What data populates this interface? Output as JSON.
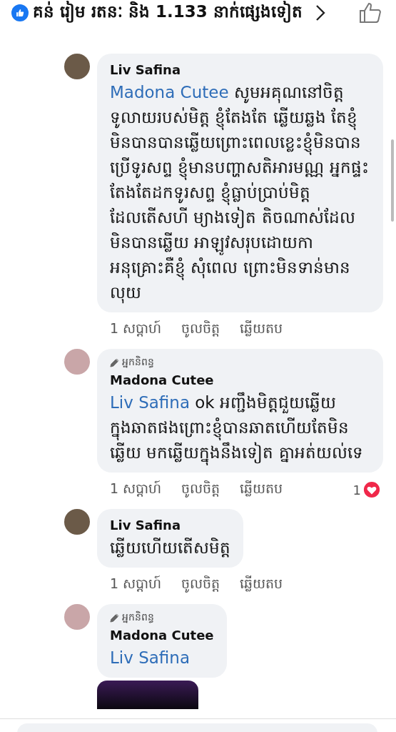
{
  "reactions_bar": {
    "text": "គន់ រៀម រតនៈ និង 1.133 នាក់ផ្សេងទៀត"
  },
  "comments": [
    {
      "author": "Liv Safina",
      "mention": "Madona Cutee",
      "text": "សូមអគុណនៅចិត្តទូលាយរបស់មិត្ត ខ្ញុំតែងតែ ឆ្លើយឆ្លង តែខ្ញុំមិនបានបានឆ្លើយព្រោះពេលខ្លេះខ្ញុំមិនបានប្រើទូរសព្ទ ខ្ញុំមានបញ្ហាសតិអារមណ្ណ អ្នកផ្ទះតែងតែដកទូរសព្ទ ខ្ញុំធ្លាប់ប្រាប់មិត្ត ដែលតើសហី ម្យាងទៀត តិចណាស់ដែល មិនបានឆ្លើយ អាឡូវសរុបដោយកា អនុគ្រោះគឺខ្ញុំ សុំពេល ព្រោះមិនទាន់មាន លុយ",
      "time": "1 សប្តាហ៍",
      "like": "ចូលចិត្ត",
      "reply": "ឆ្លើយតប"
    },
    {
      "author_badge": "អ្នកនិពន្ធ",
      "author": "Madona Cutee",
      "mention": "Liv Safina",
      "text": "ok អញ្ជឹងមិត្តជួយឆ្លើយក្នុងឆាតផងព្រោះខ្ញុំបានឆាតហើយតែមិនឆ្លើយ មកឆ្លើយក្នុងនឹងទៀត គ្នាអត់យល់ទេ",
      "time": "1 សប្តាហ៍",
      "like": "ចូលចិត្ត",
      "reply": "ឆ្លើយតប",
      "reaction": {
        "kind": "love",
        "count": "1"
      }
    },
    {
      "author": "Liv Safina",
      "text": "ឆ្លើយហើយតើសមិត្ត",
      "time": "1 សប្តាហ៍",
      "like": "ចូលចិត្ត",
      "reply": "ឆ្លើយតប"
    },
    {
      "author_badge": "អ្នកនិពន្ធ",
      "author": "Madona Cutee",
      "mention": "Liv Safina",
      "attachment": {
        "kind": "screenshot"
      }
    }
  ]
}
